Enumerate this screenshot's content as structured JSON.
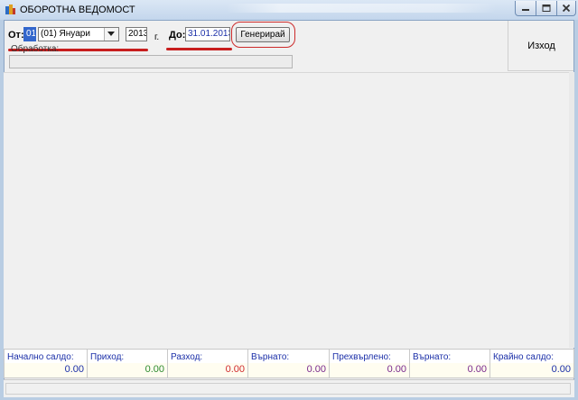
{
  "window": {
    "title": "ОБОРОТНА ВЕДОМОСТ"
  },
  "form": {
    "from_label": "От:",
    "from_day": "01",
    "month_selected": "(01) Януари",
    "year": "2013",
    "year_suffix": "г.",
    "to_label": "До:",
    "to_date": "31.01.2013",
    "generate_label": "Генерирай",
    "exit_label": "Изход",
    "processing_label": "Обработка:",
    "processing_progress": 0
  },
  "totals": [
    {
      "label": "Начално салдо:",
      "value": "0.00",
      "color": "#1b2fa8"
    },
    {
      "label": "Приход:",
      "value": "0.00",
      "color": "#2e8b2e"
    },
    {
      "label": "Разход:",
      "value": "0.00",
      "color": "#d02b2b"
    },
    {
      "label": "Върнато:",
      "value": "0.00",
      "color": "#7a2a8c"
    },
    {
      "label": "Прехвърлено:",
      "value": "0.00",
      "color": "#7a2a8c"
    },
    {
      "label": "Върнато:",
      "value": "0.00",
      "color": "#7a2a8c"
    },
    {
      "label": "Крайно салдо:",
      "value": "0.00",
      "color": "#1b2fa8"
    }
  ]
}
